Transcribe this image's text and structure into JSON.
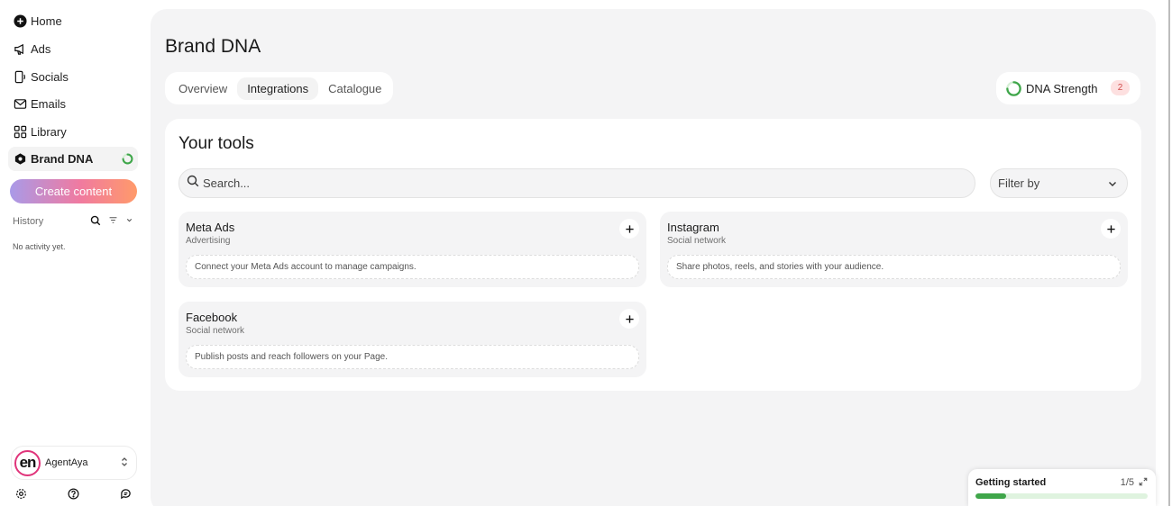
{
  "sidebar": {
    "nav": [
      {
        "label": "Home",
        "icon": "plus-circle-icon"
      },
      {
        "label": "Ads",
        "icon": "megaphone-icon"
      },
      {
        "label": "Socials",
        "icon": "phone-icon"
      },
      {
        "label": "Emails",
        "icon": "mail-icon"
      },
      {
        "label": "Library",
        "icon": "grid-icon"
      },
      {
        "label": "Brand DNA",
        "icon": "dna-icon",
        "active": true
      }
    ],
    "create_label": "Create content",
    "history_label": "History",
    "no_activity": "No activity yet.",
    "account": {
      "avatar_text": "en",
      "name": "AgentAya"
    }
  },
  "main": {
    "title": "Brand DNA",
    "tabs": [
      {
        "label": "Overview"
      },
      {
        "label": "Integrations",
        "active": true
      },
      {
        "label": "Catalogue"
      }
    ],
    "dna_strength": {
      "label": "DNA Strength",
      "badge": "2"
    },
    "tools": {
      "title": "Your tools",
      "search_placeholder": "Search...",
      "filter_label": "Filter by",
      "items": [
        {
          "name": "Meta Ads",
          "category": "Advertising",
          "description": "Connect your Meta Ads account to manage campaigns."
        },
        {
          "name": "Instagram",
          "category": "Social network",
          "description": "Share photos, reels, and stories with your audience."
        },
        {
          "name": "Facebook",
          "category": "Social network",
          "description": "Publish posts and reach followers on your Page."
        }
      ]
    }
  },
  "getting_started": {
    "title": "Getting started",
    "count": "1/5",
    "progress": 0.18
  },
  "colors": {
    "accent_green": "#3fa64a",
    "badge_red": "#d14a4a",
    "avatar_ring": "#e0347a"
  }
}
